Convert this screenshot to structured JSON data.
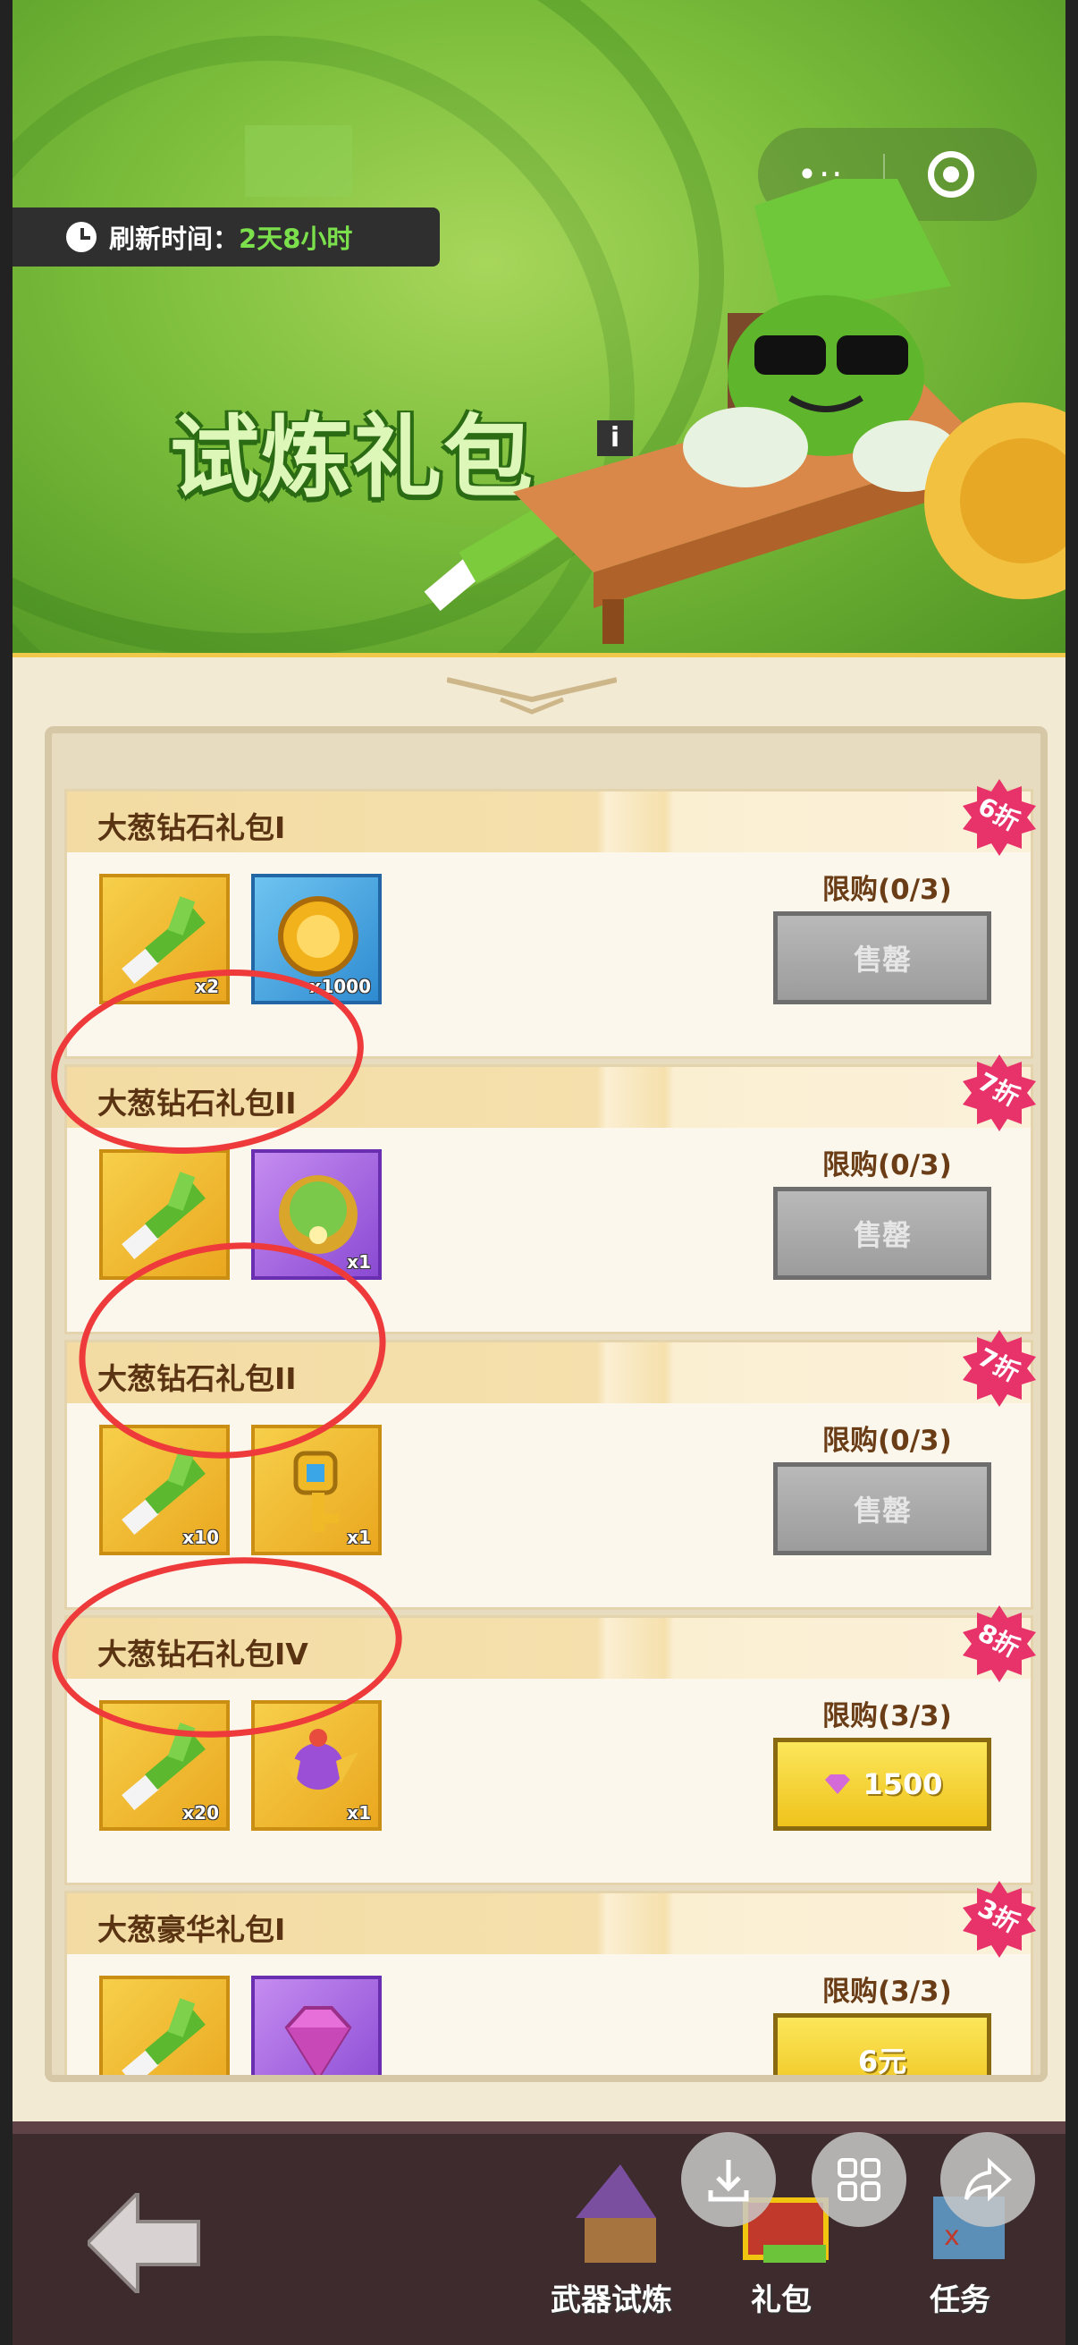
{
  "banner": {
    "timer_label": "刷新时间：",
    "timer_value": "2天8小时",
    "title": "试炼礼包",
    "info_glyph": "i",
    "capsule_dots": "•··"
  },
  "packs": [
    {
      "name": "大葱钻石礼包I",
      "discount": "6折",
      "limit": "限购(0/3)",
      "button": "售罄",
      "state": "sold",
      "items": [
        {
          "icon": "leek-icon",
          "qty": "x2",
          "bg": "gold"
        },
        {
          "icon": "gold-coin-icon",
          "qty": "x1000",
          "bg": "blue"
        }
      ]
    },
    {
      "name": "大葱钻石礼包II",
      "discount": "7折",
      "limit": "限购(0/3)",
      "button": "售罄",
      "state": "sold",
      "items": [
        {
          "icon": "leek-icon",
          "qty": "",
          "bg": "gold"
        },
        {
          "icon": "green-orb-icon",
          "qty": "x1",
          "bg": "purple"
        }
      ]
    },
    {
      "name": "大葱钻石礼包II",
      "discount": "7折",
      "limit": "限购(0/3)",
      "button": "售罄",
      "state": "sold",
      "items": [
        {
          "icon": "leek-icon",
          "qty": "x10",
          "bg": "gold"
        },
        {
          "icon": "key-icon",
          "qty": "x1",
          "bg": "gold"
        }
      ]
    },
    {
      "name": "大葱钻石礼包IV",
      "discount": "8折",
      "limit": "限购(3/3)",
      "button": "1500",
      "state": "buy-gem",
      "items": [
        {
          "icon": "leek-icon",
          "qty": "x20",
          "bg": "gold"
        },
        {
          "icon": "winged-gem-icon",
          "qty": "x1",
          "bg": "gold"
        }
      ]
    },
    {
      "name": "大葱豪华礼包I",
      "discount": "3折",
      "limit": "限购(3/3)",
      "button": "6元",
      "state": "buy",
      "items": [
        {
          "icon": "leek-icon",
          "qty": "",
          "bg": "gold"
        },
        {
          "icon": "diamond-icon",
          "qty": "",
          "bg": "purple"
        }
      ]
    }
  ],
  "nav": {
    "weapon_trial": "武器试炼",
    "gift_pack": "礼包",
    "tasks": "任务"
  },
  "colors": {
    "annotation_circle": "#ee3a3a",
    "accent_green": "#7be04b",
    "buy_button": "#f4d23a"
  }
}
